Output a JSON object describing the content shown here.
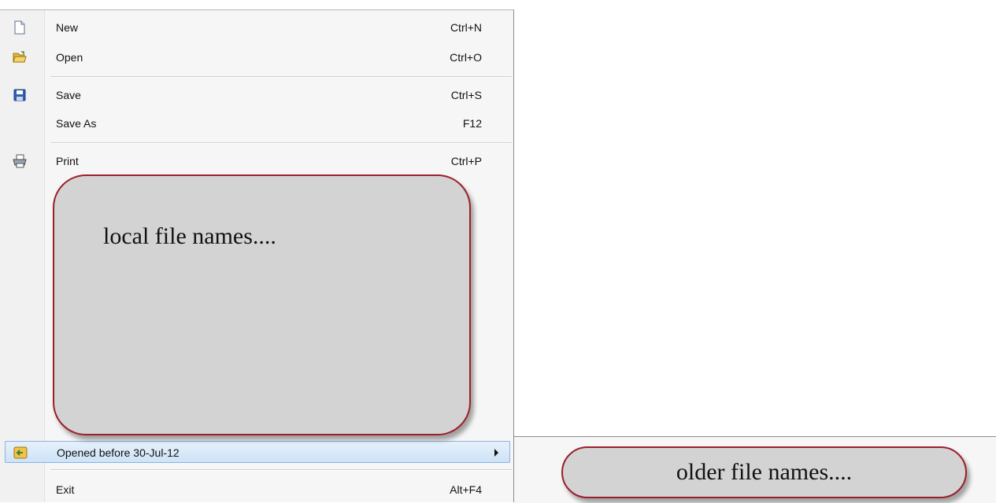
{
  "menu": {
    "items": [
      {
        "label": "New",
        "shortcut": "Ctrl+N",
        "icon": "new-document-icon"
      },
      {
        "label": "Open",
        "shortcut": "Ctrl+O",
        "icon": "open-folder-icon"
      },
      {
        "label": "Save",
        "shortcut": "Ctrl+S",
        "icon": "save-disk-icon"
      },
      {
        "label": "Save As",
        "shortcut": "F12",
        "icon": ""
      },
      {
        "label": "Print",
        "shortcut": "Ctrl+P",
        "icon": "printer-icon"
      }
    ],
    "recent": {
      "label": "Opened before 30-Jul-12",
      "icon": "history-folder-icon"
    },
    "exit": {
      "label": "Exit",
      "shortcut": "Alt+F4"
    }
  },
  "callouts": {
    "local": "local file names....",
    "older": "older file names...."
  },
  "colors": {
    "callout_fill": "#d3d3d3",
    "callout_border": "#9b1f2a",
    "highlight_border": "#8db2e3"
  }
}
